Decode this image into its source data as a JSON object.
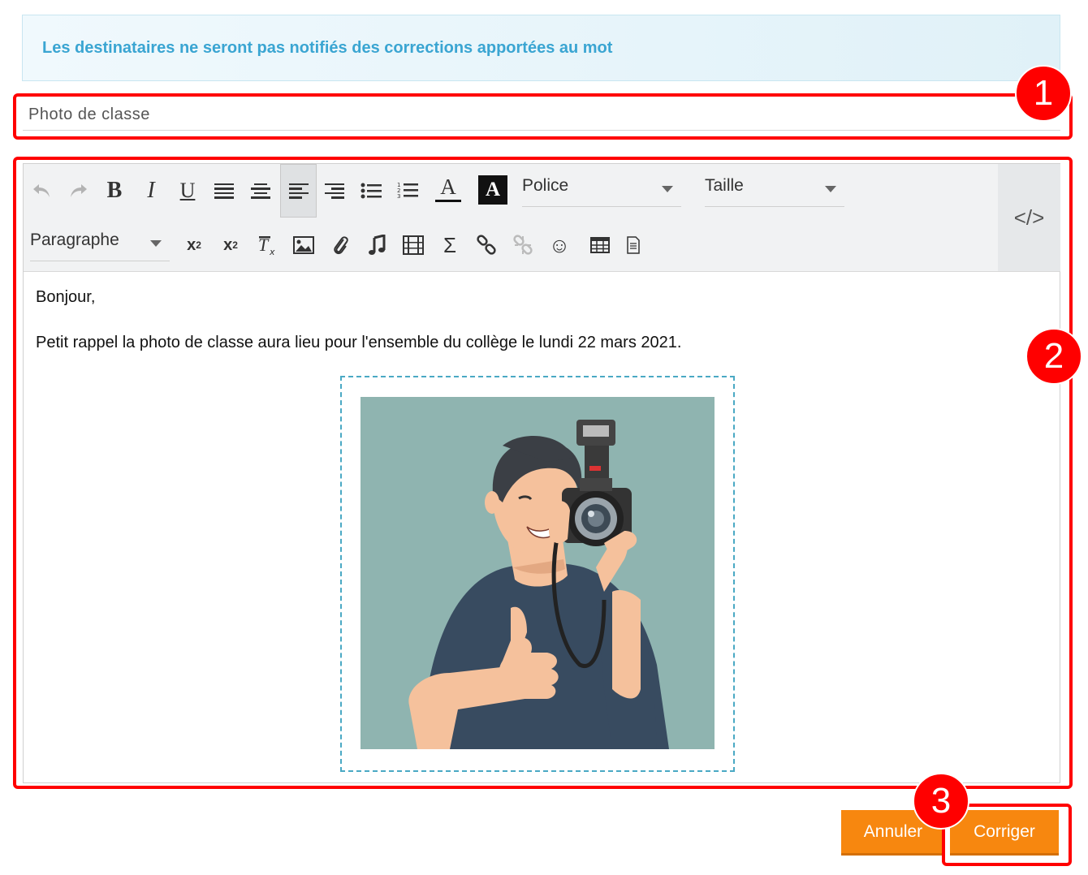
{
  "banner": {
    "text": "Les destinataires ne seront pas notifiés des corrections apportées au mot"
  },
  "subject": {
    "value": "Photo de classe"
  },
  "toolbar": {
    "police_label": "Police",
    "taille_label": "Taille",
    "format_label": "Paragraphe",
    "code_label": "</>",
    "bold": "B",
    "italic": "I",
    "underline": "U",
    "text_color": "A",
    "bg_color": "A",
    "sigma": "Σ",
    "smile": "☺"
  },
  "content": {
    "greeting": "Bonjour,",
    "body": "Petit rappel la photo de classe aura lieu pour l'ensemble du collège le lundi 22 mars 2021."
  },
  "buttons": {
    "cancel": "Annuler",
    "submit": "Corriger"
  },
  "annotations": [
    "1",
    "2",
    "3"
  ],
  "colors": {
    "accent": "#f7870f",
    "banner_text": "#3aa5d2",
    "annotation": "#ff0000",
    "photo_bg": "#8fb4b0"
  }
}
